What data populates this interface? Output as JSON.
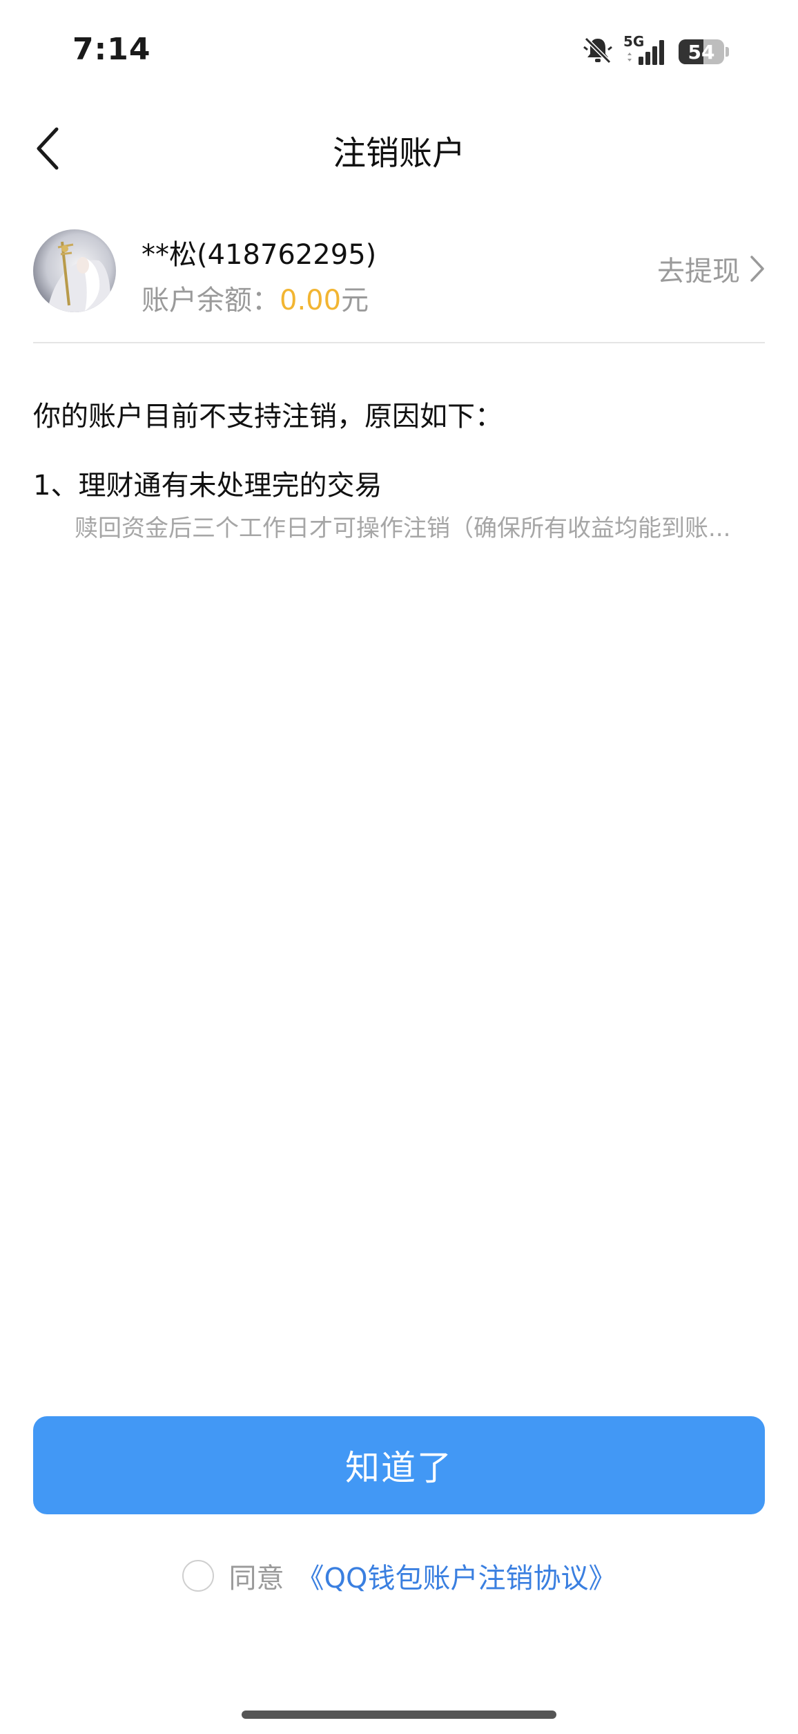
{
  "status_bar": {
    "time": "7:14",
    "network": "5G",
    "battery": "54",
    "battery_level": 0.54,
    "icons": [
      "mute-bell-icon",
      "signal-icon",
      "battery-icon"
    ]
  },
  "nav": {
    "title": "注销账户",
    "back_icon": "chevron-left-icon"
  },
  "account": {
    "name": "**松(418762295)",
    "balance_label": "账户余额：",
    "balance_value": "0.00",
    "balance_unit": "元",
    "withdraw_label": "去提现",
    "withdraw_icon": "chevron-right-icon"
  },
  "reasons": {
    "heading": "你的账户目前不支持注销，原因如下：",
    "items": [
      {
        "title": "1、理财通有未处理完的交易",
        "desc": "赎回资金后三个工作日才可操作注销（确保所有收益均能到账..."
      }
    ]
  },
  "footer": {
    "confirm_label": "知道了",
    "agree_label": "同意",
    "agreement_link": "《QQ钱包账户注销协议》"
  },
  "colors": {
    "primary": "#4298f5",
    "balance_accent": "#f2b532",
    "link": "#3a7fe0",
    "muted_text": "#9a9a9a"
  }
}
